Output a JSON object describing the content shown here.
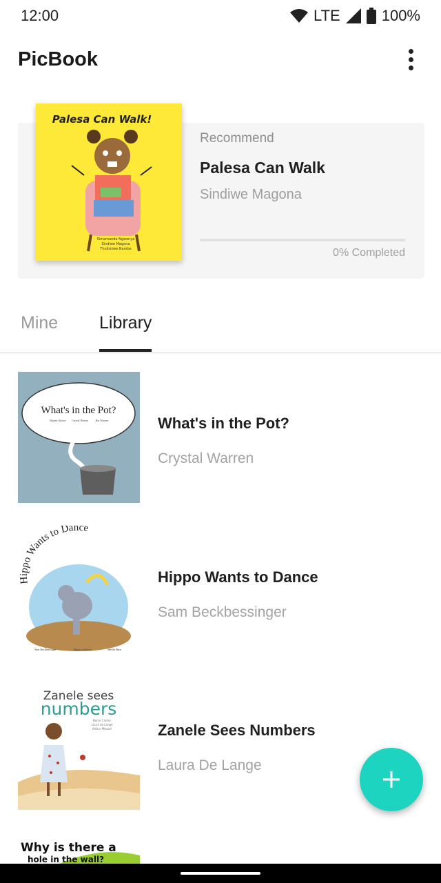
{
  "status_bar": {
    "time": "12:00",
    "network": "LTE",
    "battery": "100%"
  },
  "app_bar": {
    "title": "PicBook"
  },
  "recommend": {
    "kicker": "Recommend",
    "title": "Palesa Can Walk",
    "author": "Sindiwe Magona",
    "progress": 0,
    "progress_label": "0% Completed",
    "cover_title": "Palesa Can Walk!",
    "cover_credits": [
      "Simamande Ngwenya",
      "Sindiwe Magona",
      "Thulisizwe Nambe"
    ]
  },
  "tabs": [
    {
      "label": "Mine",
      "selected": false
    },
    {
      "label": "Library",
      "selected": true
    }
  ],
  "books": [
    {
      "title": "What's in the Pot?",
      "author": "Crystal Warren",
      "cover_title": "What's in the Pot?",
      "cover_credits": [
        "Hayley Alonso",
        "Crystal Warren",
        "Rai Wnorm"
      ]
    },
    {
      "title": "Hippo Wants to Dance",
      "author": "Sam Beckbessinger",
      "cover_title": "Hippo Wants to Dance",
      "cover_credits": [
        "Sam Beckbessinger",
        "Magus Andrews",
        "Merlin Sbyn"
      ]
    },
    {
      "title": "Zanele Sees Numbers",
      "author": "Laura De Lange",
      "cover_title_top": "Zanele sees",
      "cover_title_bottom": "numbers",
      "cover_credits": [
        "Nonie Cantor",
        "Laura de Lange",
        "Arthur Mtsulel"
      ]
    },
    {
      "cover_title_top": "Why is there a",
      "cover_title_bottom": "hole in the wall?"
    }
  ],
  "fab": {
    "icon": "plus-icon"
  },
  "colors": {
    "accent": "#1dd4c1",
    "card_bg": "#f5f5f5"
  }
}
